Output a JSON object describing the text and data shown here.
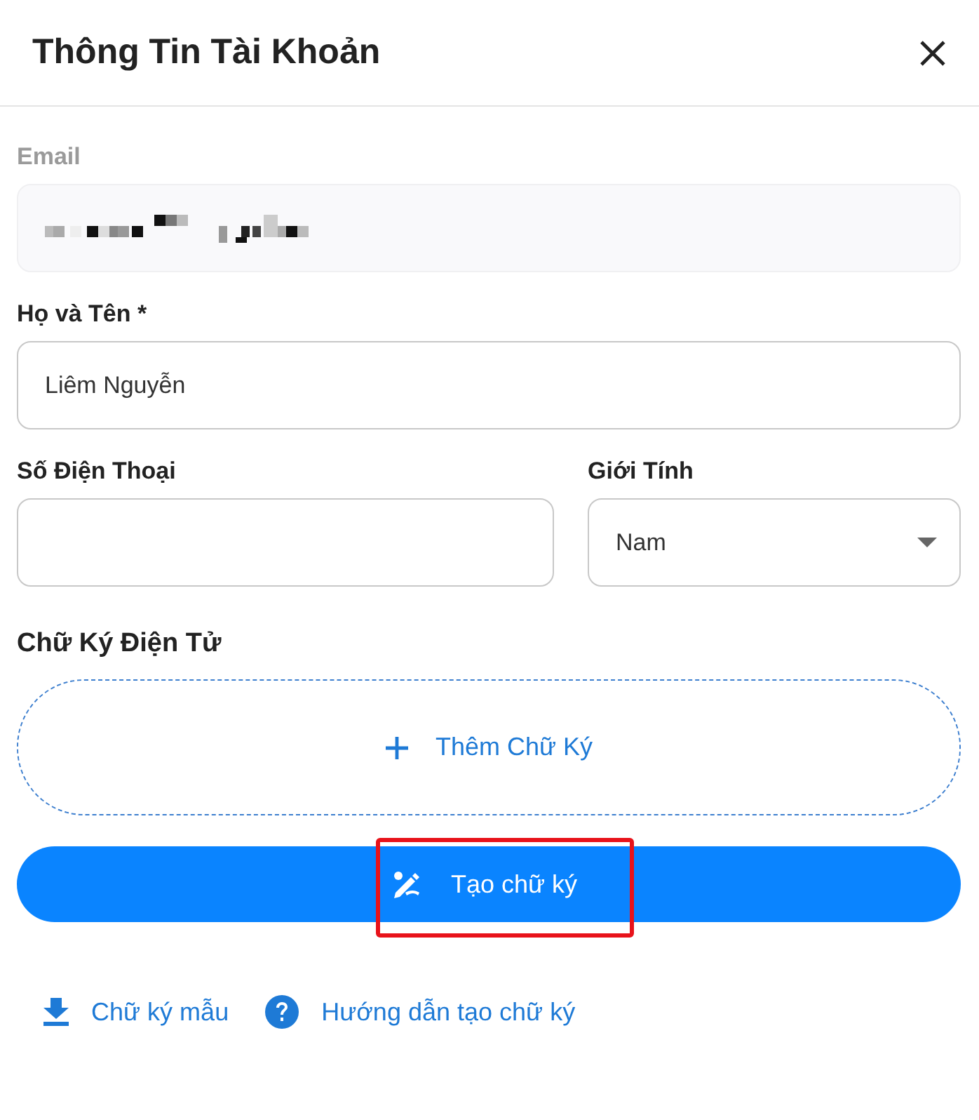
{
  "window": {
    "title": "Thông Tin Tài Khoản",
    "closable": true
  },
  "email": {
    "label": "Email",
    "disabled": true,
    "redacted": true
  },
  "full_name": {
    "label": "Họ và Tên *",
    "value": "Liêm Nguyễn"
  },
  "phone": {
    "label": "Số Điện Thoại"
  },
  "gender": {
    "label": "Giới Tính",
    "value": "Nam"
  },
  "signature": {
    "label": "Chữ Ký Điện Tử",
    "add_label": "Thêm Chữ Ký"
  },
  "create_button": {
    "label": "Tạo chữ ký",
    "highlighted": true
  },
  "links": [
    {
      "kind": "download",
      "label": "Chữ ký mẫu"
    },
    {
      "kind": "help",
      "label": "Hướng dẫn tạo chữ ký"
    }
  ]
}
